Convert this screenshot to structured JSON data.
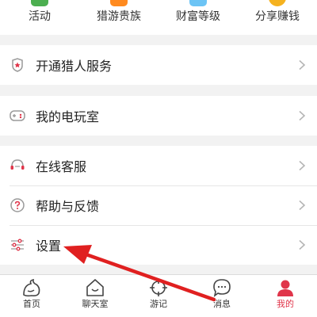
{
  "quick": [
    {
      "label": "活动",
      "color": "#4caf50"
    },
    {
      "label": "猎游贵族",
      "color": "#ff8a1f"
    },
    {
      "label": "财富等级",
      "color": "#6cc4f5"
    },
    {
      "label": "分享赚钱",
      "color": "#f5b21f"
    }
  ],
  "menu": {
    "hunter_service": "开通猎人服务",
    "game_room": "我的电玩室",
    "online_service": "在线客服",
    "help_feedback": "帮助与反馈",
    "settings": "设置"
  },
  "tabs": [
    {
      "label": "首页"
    },
    {
      "label": "聊天室"
    },
    {
      "label": "游记"
    },
    {
      "label": "消息"
    },
    {
      "label": "我的"
    }
  ],
  "colors": {
    "accent": "#e0354a",
    "arrow": "#e02020"
  }
}
